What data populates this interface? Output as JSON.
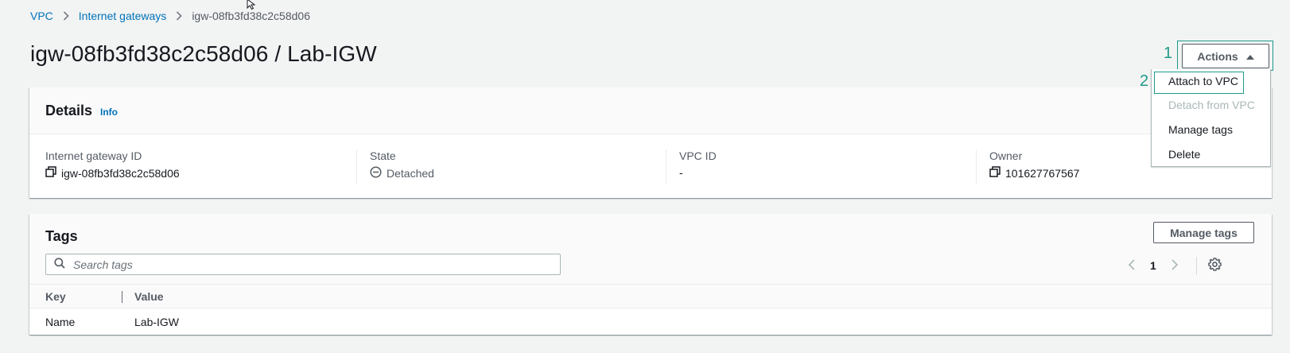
{
  "breadcrumb": {
    "items": [
      "VPC",
      "Internet gateways",
      "igw-08fb3fd38c2c58d06"
    ]
  },
  "page": {
    "title": "igw-08fb3fd38c2c58d06 / Lab-IGW"
  },
  "annotations": {
    "step1": "1",
    "step2": "2"
  },
  "actions": {
    "label": "Actions",
    "menu": [
      "Attach to VPC",
      "Detach from VPC",
      "Manage tags",
      "Delete"
    ]
  },
  "details": {
    "title": "Details",
    "info": "Info",
    "fields": [
      {
        "label": "Internet gateway ID",
        "value": "igw-08fb3fd38c2c58d06",
        "icon": "copy-icon"
      },
      {
        "label": "State",
        "value": "Detached",
        "icon": "detached-status-icon"
      },
      {
        "label": "VPC ID",
        "value": "-"
      },
      {
        "label": "Owner",
        "value": "101627767567",
        "icon": "copy-icon"
      }
    ]
  },
  "tags": {
    "title": "Tags",
    "manage_label": "Manage tags",
    "search_placeholder": "Search tags",
    "page": "1",
    "columns": [
      "Key",
      "Value"
    ],
    "rows": [
      {
        "key": "Name",
        "value": "Lab-IGW"
      }
    ]
  },
  "colors": {
    "link": "#0073bb",
    "annotation": "#1d9b89",
    "disabled": "#aab7b8"
  }
}
